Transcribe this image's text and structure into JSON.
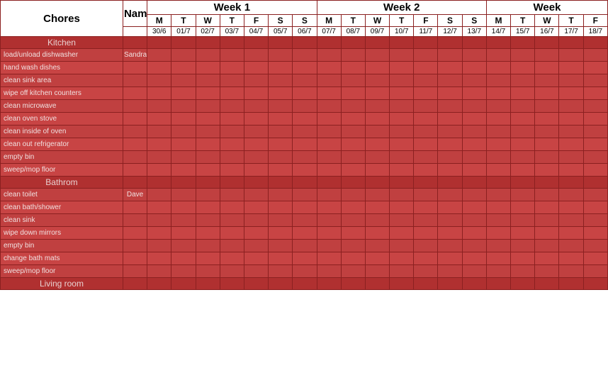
{
  "title": "Chores",
  "headers": {
    "name": "Name",
    "week1": "Week 1",
    "week2": "Week 2",
    "week3": "Week"
  },
  "days": [
    "M",
    "T",
    "W",
    "T",
    "F",
    "S",
    "S"
  ],
  "dates_week1": [
    "30/6",
    "01/7",
    "02/7",
    "03/7",
    "04/7",
    "05/7",
    "06/7"
  ],
  "dates_week2": [
    "07/7",
    "08/7",
    "09/7",
    "10/7",
    "11/7",
    "12/7",
    "13/7"
  ],
  "dates_week3": [
    "14/7",
    "15/7",
    "16/7",
    "17/7",
    "18/7"
  ],
  "sections": [
    {
      "name": "Kitchen",
      "chores": [
        {
          "label": "load/unload dishwasher",
          "name": "Sandra"
        },
        {
          "label": "hand wash dishes",
          "name": ""
        },
        {
          "label": "clean sink area",
          "name": ""
        },
        {
          "label": "wipe off kitchen counters",
          "name": ""
        },
        {
          "label": "clean microwave",
          "name": ""
        },
        {
          "label": "clean oven stove",
          "name": ""
        },
        {
          "label": "clean inside of oven",
          "name": ""
        },
        {
          "label": "clean out refrigerator",
          "name": ""
        },
        {
          "label": "empty bin",
          "name": ""
        },
        {
          "label": "sweep/mop floor",
          "name": ""
        }
      ]
    },
    {
      "name": "Bathrom",
      "chores": [
        {
          "label": "clean toilet",
          "name": "Dave"
        },
        {
          "label": "clean bath/shower",
          "name": ""
        },
        {
          "label": "clean sink",
          "name": ""
        },
        {
          "label": "wipe down mirrors",
          "name": ""
        },
        {
          "label": "empty bin",
          "name": ""
        },
        {
          "label": "change bath mats",
          "name": ""
        },
        {
          "label": "sweep/mop floor",
          "name": ""
        }
      ]
    },
    {
      "name": "Living room",
      "chores": []
    }
  ]
}
